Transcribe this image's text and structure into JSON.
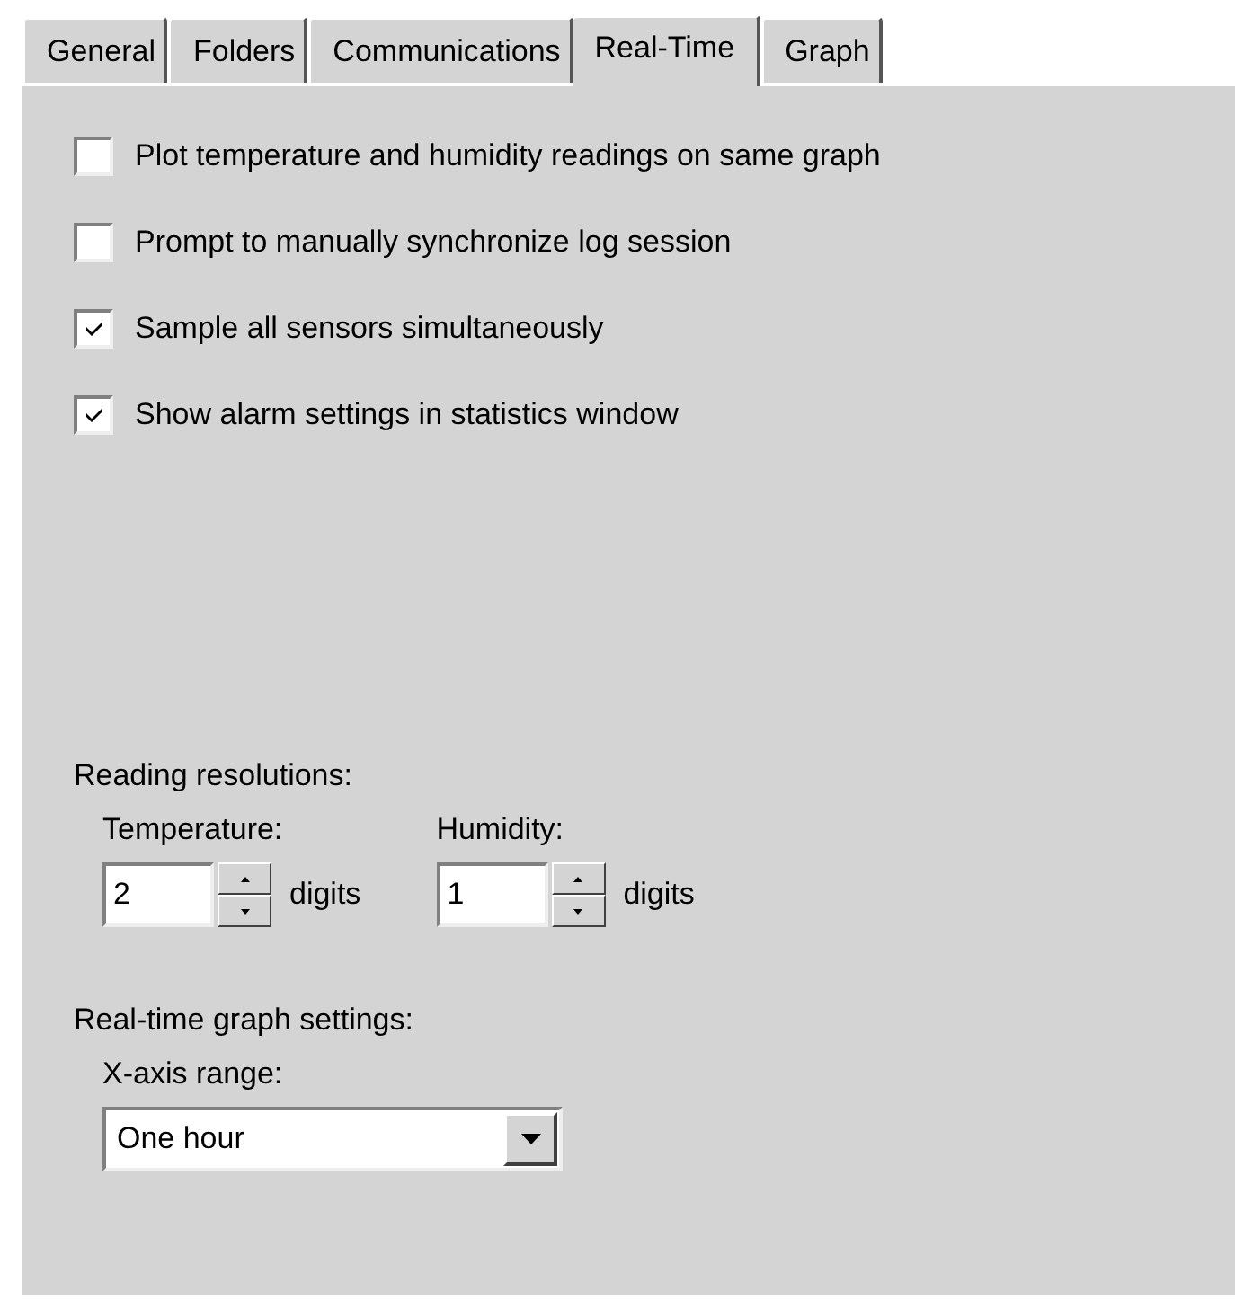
{
  "tabs": [
    {
      "label": "General",
      "selected": false
    },
    {
      "label": "Folders",
      "selected": false
    },
    {
      "label": "Communications",
      "selected": false
    },
    {
      "label": "Real-Time",
      "selected": true
    },
    {
      "label": "Graph",
      "selected": false
    }
  ],
  "options": [
    {
      "label": "Plot temperature and humidity readings on same graph",
      "checked": false
    },
    {
      "label": "Prompt to manually synchronize log session",
      "checked": false
    },
    {
      "label": "Sample all sensors simultaneously",
      "checked": true
    },
    {
      "label": "Show alarm settings in statistics window",
      "checked": true
    }
  ],
  "reading_resolutions": {
    "title": "Reading resolutions:",
    "fields": [
      {
        "label": "Temperature:",
        "value": "2",
        "unit": "digits"
      },
      {
        "label": "Humidity:",
        "value": "1",
        "unit": "digits"
      }
    ]
  },
  "graph_settings": {
    "title": "Real-time graph settings:",
    "range_label": "X-axis range:",
    "range_value": "One hour"
  }
}
